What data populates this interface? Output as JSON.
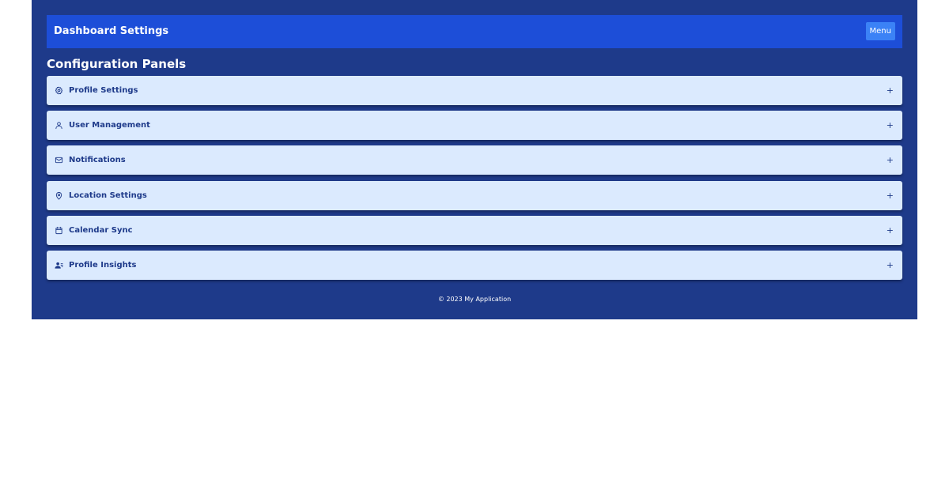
{
  "header": {
    "title": "Dashboard Settings",
    "menu_label": "Menu"
  },
  "main": {
    "section_title": "Configuration Panels",
    "panels": [
      {
        "label": "Profile Settings",
        "icon": "gear-icon",
        "toggle": "+"
      },
      {
        "label": "User Management",
        "icon": "user-icon",
        "toggle": "+"
      },
      {
        "label": "Notifications",
        "icon": "envelope-icon",
        "toggle": "+"
      },
      {
        "label": "Location Settings",
        "icon": "location-pin-icon",
        "toggle": "+"
      },
      {
        "label": "Calendar Sync",
        "icon": "calendar-icon",
        "toggle": "+"
      },
      {
        "label": "Profile Insights",
        "icon": "user-list-icon",
        "toggle": "+"
      }
    ]
  },
  "footer": {
    "text": "© 2023 My Application"
  },
  "colors": {
    "app_background": "#1e3a8a",
    "header_background": "#1d4ed8",
    "menu_button": "#3b82f6",
    "panel_background": "#dbeafe",
    "panel_text": "#1e3a8a",
    "page_background": "#ffffff"
  }
}
